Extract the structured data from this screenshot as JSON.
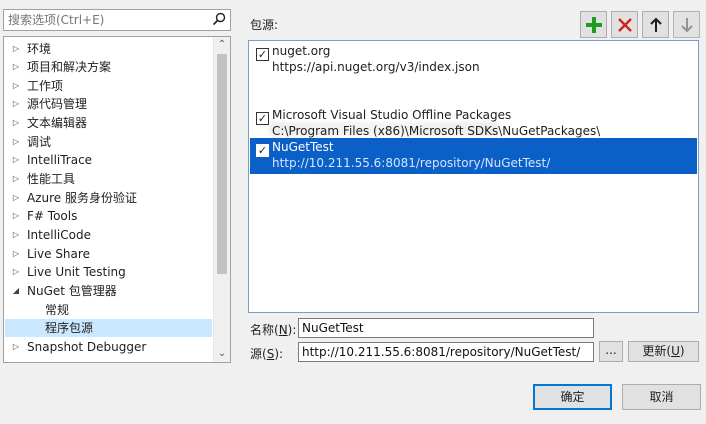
{
  "search": {
    "placeholder": "搜索选项(Ctrl+E)"
  },
  "tree": {
    "items": [
      {
        "label": "环境",
        "arrow": "▷"
      },
      {
        "label": "项目和解决方案",
        "arrow": "▷"
      },
      {
        "label": "工作项",
        "arrow": "▷"
      },
      {
        "label": "源代码管理",
        "arrow": "▷"
      },
      {
        "label": "文本编辑器",
        "arrow": "▷"
      },
      {
        "label": "调试",
        "arrow": "▷"
      },
      {
        "label": "IntelliTrace",
        "arrow": "▷"
      },
      {
        "label": "性能工具",
        "arrow": "▷"
      },
      {
        "label": "Azure 服务身份验证",
        "arrow": "▷"
      },
      {
        "label": "F# Tools",
        "arrow": "▷"
      },
      {
        "label": "IntelliCode",
        "arrow": "▷"
      },
      {
        "label": "Live Share",
        "arrow": "▷"
      },
      {
        "label": "Live Unit Testing",
        "arrow": "▷"
      },
      {
        "label": "NuGet 包管理器",
        "arrow": "◢"
      },
      {
        "label": "常规",
        "arrow": ""
      },
      {
        "label": "程序包源",
        "arrow": ""
      },
      {
        "label": "Snapshot Debugger",
        "arrow": "▷"
      }
    ],
    "scroll_up": "⌃",
    "scroll_down": "⌄"
  },
  "sources": {
    "label": "包源:",
    "list": [
      {
        "name": "nuget.org",
        "url": "https://api.nuget.org/v3/index.json",
        "checked": "✓"
      },
      {
        "name": "Microsoft Visual Studio Offline Packages",
        "url": "C:\\Program Files (x86)\\Microsoft SDKs\\NuGetPackages\\",
        "checked": "✓"
      },
      {
        "name": "NuGetTest",
        "url": "http://10.211.55.6:8081/repository/NuGetTest/",
        "checked": "✓"
      }
    ]
  },
  "toolbar": {
    "add_color": "#1e9e1e",
    "remove_color": "#d02020",
    "up_color": "#1e1e1e",
    "down_color": "#8a8a8a"
  },
  "form": {
    "name_label_prefix": "名称(",
    "name_label_key": "N",
    "name_label_suffix": "):",
    "name_value": "NuGetTest",
    "source_label_prefix": "源(",
    "source_label_key": "S",
    "source_label_suffix": "):",
    "source_value": "http://10.211.55.6:8081/repository/NuGetTest/",
    "browse_label": "...",
    "update_label_prefix": "更新(",
    "update_label_key": "U",
    "update_label_suffix": ")"
  },
  "dialog": {
    "ok_label": "确定",
    "cancel_label": "取消"
  }
}
